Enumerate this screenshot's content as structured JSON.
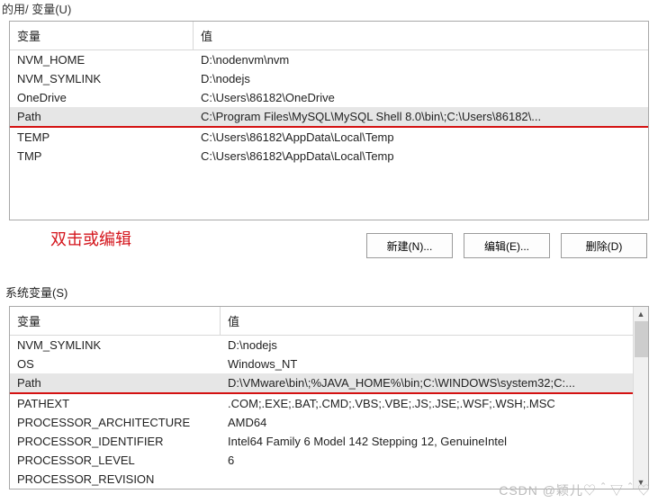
{
  "top_title_fragment": "的用/ 变量(U)",
  "columns": {
    "var": "变量",
    "val": "值"
  },
  "user_vars": [
    {
      "name": "NVM_HOME",
      "value": "D:\\nodenvm\\nvm"
    },
    {
      "name": "NVM_SYMLINK",
      "value": "D:\\nodejs"
    },
    {
      "name": "OneDrive",
      "value": "C:\\Users\\86182\\OneDrive"
    },
    {
      "name": "Path",
      "value": "C:\\Program Files\\MySQL\\MySQL Shell 8.0\\bin\\;C:\\Users\\86182\\...",
      "selected": true,
      "underlined": true
    },
    {
      "name": "TEMP",
      "value": "C:\\Users\\86182\\AppData\\Local\\Temp"
    },
    {
      "name": "TMP",
      "value": "C:\\Users\\86182\\AppData\\Local\\Temp"
    }
  ],
  "annotation_text": "双击或编辑",
  "buttons": {
    "new": "新建(N)...",
    "edit": "编辑(E)...",
    "delete": "删除(D)"
  },
  "system_section_label": "系统变量(S)",
  "system_vars": [
    {
      "name": "NVM_SYMLINK",
      "value": "D:\\nodejs"
    },
    {
      "name": "OS",
      "value": "Windows_NT"
    },
    {
      "name": "Path",
      "value": "D:\\VMware\\bin\\;%JAVA_HOME%\\bin;C:\\WINDOWS\\system32;C:...",
      "selected": true,
      "underlined": true
    },
    {
      "name": "PATHEXT",
      "value": ".COM;.EXE;.BAT;.CMD;.VBS;.VBE;.JS;.JSE;.WSF;.WSH;.MSC"
    },
    {
      "name": "PROCESSOR_ARCHITECTURE",
      "value": "AMD64"
    },
    {
      "name": "PROCESSOR_IDENTIFIER",
      "value": "Intel64 Family 6 Model 142 Stepping 12, GenuineIntel"
    },
    {
      "name": "PROCESSOR_LEVEL",
      "value": "6"
    },
    {
      "name": "PROCESSOR_REVISION",
      "value": ""
    }
  ],
  "watermark": "CSDN @颖儿♡＾▽＾♡"
}
